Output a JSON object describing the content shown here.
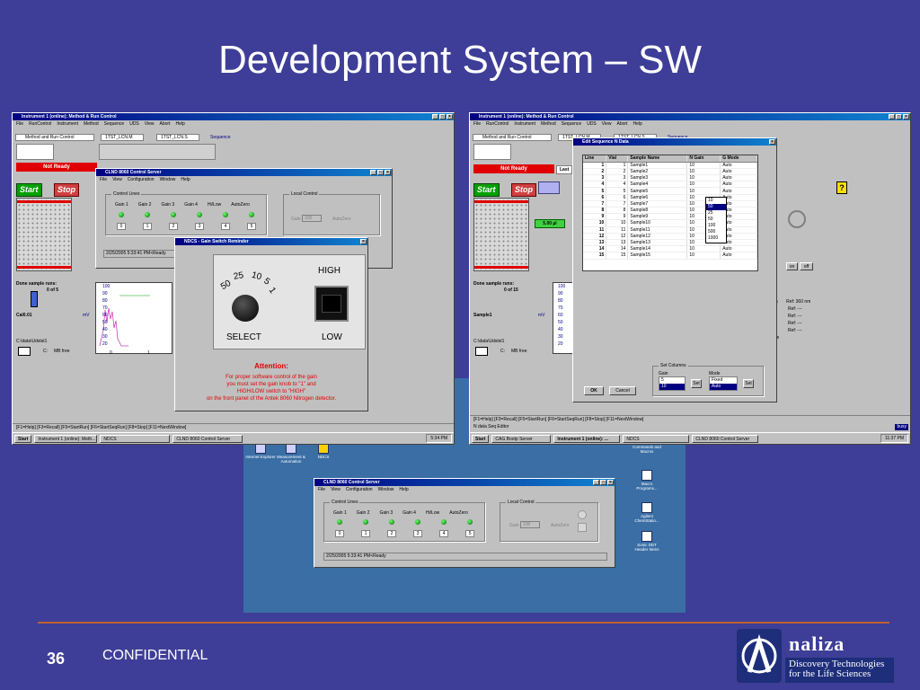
{
  "slide": {
    "title": "Development System – SW",
    "page_number": "36",
    "confidential": "CONFIDENTIAL",
    "logo_name": "naliza",
    "logo_tagline_1": "Discovery Technologies",
    "logo_tagline_2": "for the Life Sciences",
    "colors": {
      "background": "#3e3e98",
      "footer_line": "#c06030",
      "title_bar": "#000080",
      "not_ready": "#e00000"
    }
  },
  "left_window": {
    "title": "Instrument 1 (online): Method & Run Control",
    "menu": [
      "File",
      "RunControl",
      "Instrument",
      "Method",
      "Sequence",
      "UDS",
      "View",
      "Abort",
      "Help"
    ],
    "toolbar_select": "Method and Run Control",
    "method_box": "1TST_LCN.M",
    "seq_box": "1TST_LCN.S",
    "sequence_label": "Sequence",
    "status": "Not Ready",
    "start_label": "Start",
    "stop_label": "Stop",
    "done_runs_label": "Done sample runs:",
    "done_runs_value": "0 of 5",
    "sample_name": "Cal0.01",
    "path": "C:\\data\\Udstst1",
    "drive": "C:",
    "free": "MB free",
    "plot_ylabel": "mV",
    "plot_yticks": [
      "100",
      "90",
      "80",
      "70",
      "60",
      "50",
      "40",
      "30",
      "20"
    ],
    "plot_xticks": [
      "0",
      "1"
    ],
    "status_bar": "[F1=Help] [F3=Recall] [F5=StartRun] [F6=StartSeqRun] [F8=Stop] [F11=NextWindow]",
    "taskbar": {
      "start": "Start",
      "items": [
        "Instrument 1 (online): Meth...",
        "NDCS",
        "CLND 8060 Control Server"
      ],
      "clock": "5:34 PM"
    }
  },
  "clnd_popup": {
    "title": "CLND 8060 Control Server",
    "menu": [
      "File",
      "View",
      "Configuration",
      "Window",
      "Help"
    ],
    "control_lines_label": "Control Lines",
    "line_labels": [
      "Gain 1",
      "Gain 2",
      "Gain 3",
      "Gain 4",
      "Hi/Low",
      "AutoZero"
    ],
    "line_values": [
      "0",
      "1",
      "2",
      "3",
      "4",
      "5"
    ],
    "local_control_label": "Local Control",
    "gain_label": "Gain",
    "gain_value": "100",
    "autozero_label": "AutoZero",
    "status": "2/25/2005  5:33:41 PM<Ready"
  },
  "gain_dialog": {
    "title": "NDCS - Gain Switch Reminder",
    "dial_numbers": [
      "50",
      "25",
      "10",
      "5",
      "1"
    ],
    "select_label": "SELECT",
    "high_label": "HIGH",
    "low_label": "LOW",
    "attention": "Attention:",
    "msg1": "For proper software control of the gain",
    "msg2": "you must set the gain knob to \"1\" and",
    "msg3": "HIGH/LOW switch to \"HIGH\"",
    "msg4": "on the front panel of the Antek 8060 Nitrogen detector."
  },
  "right_window": {
    "title": "Instrument 1 (online): Method & Run Control",
    "menu": [
      "File",
      "RunControl",
      "Instrument",
      "Method",
      "Sequence",
      "UDS",
      "View",
      "Abort",
      "Help"
    ],
    "toolbar_select": "Method and Run Control",
    "method_box": "1TST_LCN.M",
    "seq_box": "1TST_LCN.S",
    "sequence_label": "Sequence",
    "status": "Not Ready",
    "last_label": "Last",
    "start_label": "Start",
    "stop_label": "Stop",
    "injection": "5.00 µl",
    "done_runs_label": "Done sample runs:",
    "done_runs_value": "0 of 15",
    "sample_name": "Sample1",
    "path": "C:\\data\\Udstst1",
    "drive": "C:",
    "free": "MB free",
    "plot_ylabel": "mV",
    "plot_yticks": [
      "100",
      "90",
      "80",
      "70",
      "60",
      "50",
      "40",
      "30",
      "20"
    ],
    "on_label": "on",
    "off_label": "off",
    "ref_lines": [
      "Ref: 360 nm",
      "Ref: ---",
      "Ref: ---",
      "Ref: ---",
      "Ref: ---"
    ],
    "ref_prefix": [
      "ain",
      "",
      "",
      "",
      ""
    ],
    "none_label": "one",
    "status_bar": "[F1=Help] [F3=Recall] [F5=StartRun] [F6=StartSeqRun] [F8=Stop] [F11=NextWindow]",
    "editor_status": "N data Seq Editor",
    "busy": "busy",
    "taskbar": {
      "start": "Start",
      "items": [
        "CAG Bootp Server",
        "Instrument 1 (online): ...",
        "NDCS",
        "CLND 8060 Control Server"
      ],
      "clock": "11:37 PM"
    }
  },
  "seq_dialog": {
    "title": "Edit Sequence N Data",
    "columns": [
      "Line",
      "Vial",
      "Sample Name",
      "N Gain",
      "G Mode"
    ],
    "rows": [
      [
        "1",
        "1",
        "Sample1",
        "10",
        "Auto"
      ],
      [
        "2",
        "2",
        "Sample2",
        "10",
        "Auto"
      ],
      [
        "3",
        "3",
        "Sample3",
        "10",
        "Auto"
      ],
      [
        "4",
        "4",
        "Sample4",
        "10",
        "Auto"
      ],
      [
        "5",
        "5",
        "Sample5",
        "10",
        "Auto"
      ],
      [
        "6",
        "6",
        "Sample6",
        "10",
        "Auto"
      ],
      [
        "7",
        "7",
        "Sample7",
        "10",
        "Auto"
      ],
      [
        "8",
        "8",
        "Sample8",
        "10",
        "Auto"
      ],
      [
        "9",
        "9",
        "Sample9",
        "10",
        "Auto"
      ],
      [
        "10",
        "10",
        "Sample10",
        "10",
        "Auto"
      ],
      [
        "11",
        "11",
        "Sample11",
        "10",
        "Auto"
      ],
      [
        "12",
        "12",
        "Sample12",
        "10",
        "Auto"
      ],
      [
        "13",
        "13",
        "Sample13",
        "10",
        "Auto"
      ],
      [
        "14",
        "14",
        "Sample14",
        "10",
        "Auto"
      ],
      [
        "15",
        "15",
        "Sample15",
        "10",
        "Auto"
      ]
    ],
    "dropdown_options": [
      "10",
      "50",
      "25",
      "50",
      "100",
      "500",
      "1000"
    ],
    "set_columns_label": "Set Columns",
    "gain_label": "Gain",
    "gain_options": [
      "5",
      "10"
    ],
    "mode_label": "Mode",
    "mode_options": [
      "Fixed",
      "Auto"
    ],
    "set_label": "Set",
    "ok_label": "OK",
    "cancel_label": "Cancel"
  },
  "desktop": {
    "icons": [
      "Internet Explorer",
      "Measurement & Automation",
      "NDCS"
    ],
    "right_icons": [
      "Commands and Macros",
      "Macro Programs...",
      "Agilent ChemStatio...",
      "Sonic DDT Header Items"
    ],
    "clnd_window": {
      "title": "CLND 8060 Control Server",
      "menu": [
        "File",
        "View",
        "Configuration",
        "Window",
        "Help"
      ],
      "control_lines_label": "Control Lines",
      "line_labels": [
        "Gain 1",
        "Gain 2",
        "Gain 3",
        "Gain 4",
        "Hi/Low",
        "AutoZero"
      ],
      "line_values": [
        "0",
        "1",
        "2",
        "3",
        "4",
        "5"
      ],
      "local_control_label": "Local Control",
      "gain_label": "Gain",
      "gain_value": "100",
      "autozero_label": "AutoZero",
      "status": "2/25/2005  5:33:41 PM<Ready"
    }
  }
}
